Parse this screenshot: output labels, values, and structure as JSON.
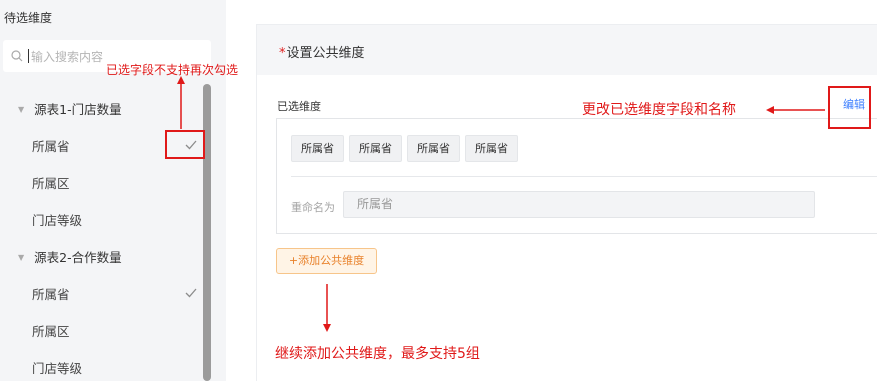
{
  "left_panel": {
    "title": "待选维度",
    "search_placeholder": "输入搜索内容",
    "groups": [
      {
        "label": "源表1-门店数量",
        "fields": [
          "所属省",
          "所属区",
          "门店等级"
        ],
        "checked": [
          true,
          false,
          false
        ]
      },
      {
        "label": "源表2-合作数量",
        "fields": [
          "所属省",
          "所属区",
          "门店等级"
        ],
        "checked": [
          true,
          false,
          false
        ]
      }
    ]
  },
  "right_panel": {
    "title": "设置公共维度",
    "required_mark": "*",
    "selected_label": "已选维度",
    "edit_label": "编辑",
    "tags": [
      "所属省",
      "所属省",
      "所属省",
      "所属省"
    ],
    "rename_label": "重命名为",
    "rename_value": "所属省",
    "add_button": "+添加公共维度"
  },
  "annotations": {
    "checked_note": "已选字段不支持再次勾选",
    "edit_note": "更改已选维度字段和名称",
    "add_note": "继续添加公共维度，最多支持5组",
    "color": "#e01919"
  }
}
